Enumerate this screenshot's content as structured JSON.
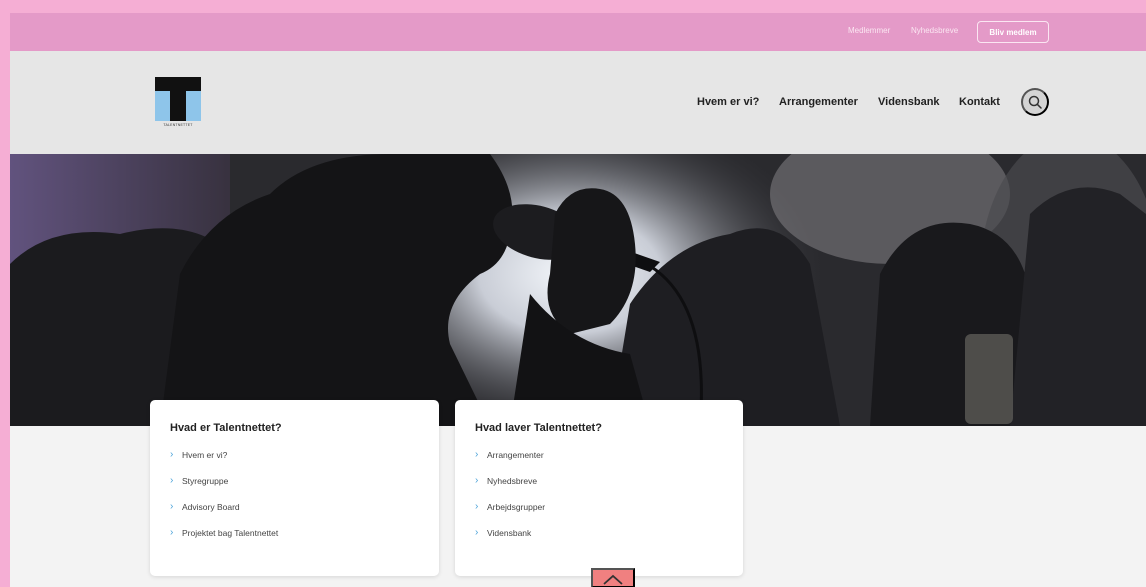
{
  "topbar": {
    "members_label": "Medlemmer",
    "newsletters_label": "Nyhedsbreve",
    "join_label": "Bliv medlem"
  },
  "header": {
    "logo_text": "TALENTNETTET",
    "nav": [
      {
        "label": "Hvem er vi?"
      },
      {
        "label": "Arrangementer"
      },
      {
        "label": "Vidensbank"
      },
      {
        "label": "Kontakt"
      }
    ],
    "search_icon": "search-icon"
  },
  "cards": [
    {
      "title": "Hvad er Talentnettet?",
      "items": [
        "Hvem er vi?",
        "Styregruppe",
        "Advisory Board",
        "Projektet bag Talentnettet"
      ]
    },
    {
      "title": "Hvad laver Talentnettet?",
      "items": [
        "Arrangementer",
        "Nyhedsbreve",
        "Arbejdsgrupper",
        "Vidensbank"
      ]
    }
  ],
  "colors": {
    "outer_background": "#f5aed4",
    "topbar": "#e49ac8",
    "header": "#e6e6e6",
    "logo_accent": "#8ec5ea",
    "link_chevron": "#4aa3d9",
    "back_to_top": "#f08080"
  },
  "icons": {
    "search": "search-icon",
    "chevron": "chevron-right-icon",
    "back_to_top": "chevron-up-icon"
  }
}
